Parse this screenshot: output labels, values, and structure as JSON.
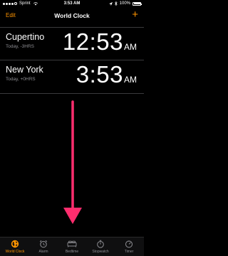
{
  "status_bar": {
    "carrier": "Sprint",
    "time": "3:53 AM",
    "battery": "100%",
    "battery_level": 1.0
  },
  "nav": {
    "edit_label": "Edit",
    "title": "World Clock",
    "add_label": "+"
  },
  "clocks": [
    {
      "city": "Cupertino",
      "offset": "Today, -3HRS",
      "time": "12:53",
      "ampm": "AM"
    },
    {
      "city": "New York",
      "offset": "Today, +0HRS",
      "time": "3:53",
      "ampm": "AM"
    }
  ],
  "tabs": [
    {
      "label": "World Clock",
      "icon": "globe-icon",
      "active": true
    },
    {
      "label": "Alarm",
      "icon": "alarm-clock-icon",
      "active": false
    },
    {
      "label": "Bedtime",
      "icon": "bed-icon",
      "active": false
    },
    {
      "label": "Stopwatch",
      "icon": "stopwatch-icon",
      "active": false
    },
    {
      "label": "Timer",
      "icon": "timer-icon",
      "active": false
    }
  ],
  "colors": {
    "accent": "#ff9500",
    "arrow": "#ff2d6e",
    "inactive": "#8e8e93",
    "background": "#000000"
  }
}
